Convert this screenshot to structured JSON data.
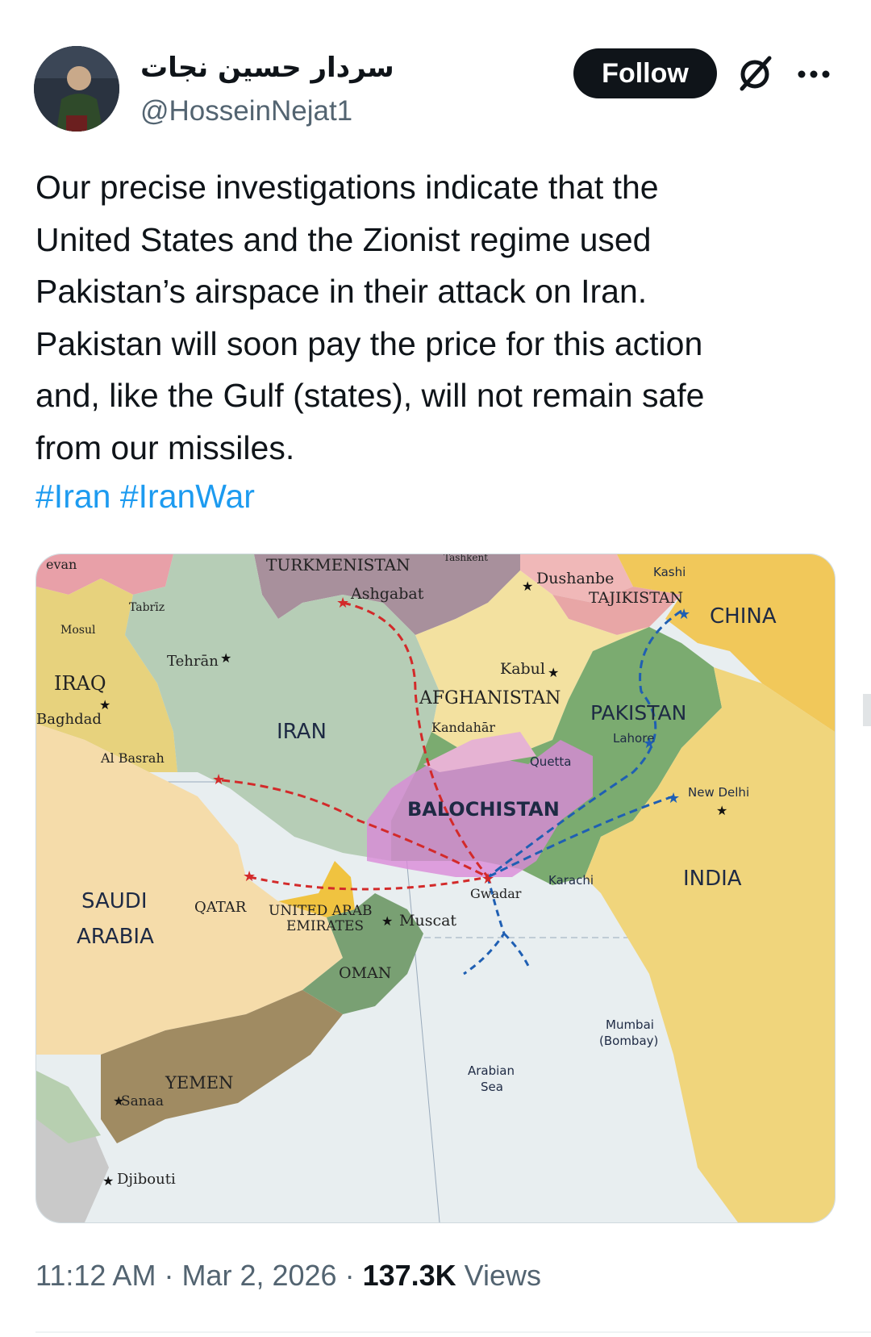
{
  "author": {
    "display_name": "سردار حسین نجات",
    "handle": "@HosseinNejat1"
  },
  "header": {
    "follow_label": "Follow",
    "grok_icon": "grok-icon",
    "more_icon": "more-horizontal-icon"
  },
  "post": {
    "text": "Our precise investigations indicate that the\nUnited States and the Zionist regime used\nPakistan’s airspace in their attack on Iran.\nPakistan will soon pay the price for this action\nand, like the Gulf (states), will not remain safe\nfrom our missiles.",
    "hashtags": [
      "#Iran",
      "#IranWar"
    ]
  },
  "map": {
    "countries": {
      "turkmenistan": "TURKMENISTAN",
      "tajikistan": "TAJIKISTAN",
      "china": "CHINA",
      "iraq": "IRAQ",
      "iran": "IRAN",
      "afghanistan": "AFGHANISTAN",
      "pakistan": "PAKISTAN",
      "balochistan": "BALOCHISTAN",
      "india": "INDIA",
      "saudi_arabia_1": "SAUDI",
      "saudi_arabia_2": "ARABIA",
      "qatar": "QATAR",
      "uae_1": "UNITED ARAB",
      "uae_2": "EMIRATES",
      "oman": "OMAN",
      "yemen": "YEMEN"
    },
    "cities": {
      "yerevan": "evan",
      "tabriz": "Tabrīz",
      "mosul": "Mosul",
      "tehran": "Tehrān",
      "baghdad": "Baghdad",
      "al_basrah": "Al Basrah",
      "ashgabat": "Ashgabat",
      "tashkent": "Tashkent",
      "dushanbe": "Dushanbe",
      "kashi": "Kashi",
      "kabul": "Kabul",
      "kandahar": "Kandahār",
      "quetta": "Quetta",
      "lahore": "Lahore",
      "new_delhi": "New Delhi",
      "karachi": "Karachi",
      "gwadar": "Gwadar",
      "muscat": "Muscat",
      "mumbai_1": "Mumbai",
      "mumbai_2": "(Bombay)",
      "sanaa": "Sanaa",
      "djibouti": "Djibouti"
    },
    "sea": {
      "line1": "Arabian",
      "line2": "Sea"
    }
  },
  "meta": {
    "time": "11:12 AM",
    "separator": " · ",
    "date": "Mar 2, 2026",
    "views_count": "137.3K",
    "views_label": " Views"
  }
}
